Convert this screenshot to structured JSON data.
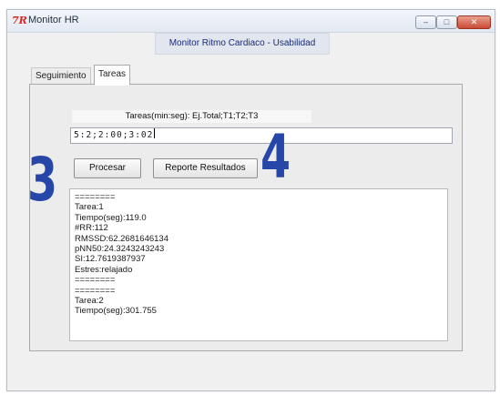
{
  "window": {
    "title": "Monitor HR",
    "icon_glyph": "7R",
    "controls": {
      "minimize_glyph": "–",
      "maximize_glyph": "□",
      "close_glyph": "✕"
    }
  },
  "header": {
    "title": "Monitor Ritmo Cardiaco - Usabilidad"
  },
  "tabs": [
    {
      "label": "Seguimiento",
      "active": false
    },
    {
      "label": "Tareas",
      "active": true
    }
  ],
  "tareas": {
    "format_label": "Tareas(min:seg): Ej.Total;T1;T2;T3",
    "input_value": "5:2;2:00;3:02",
    "buttons": {
      "procesar": "Procesar",
      "reporte": "Reporte Resultados"
    },
    "results_lines": [
      "========",
      "Tarea:1",
      "Tiempo(seg):119.0",
      "#RR:112",
      "RMSSD:62.2681646134",
      "pNN50:24.3243243243",
      "SI:12.7619387937",
      "Estres:relajado",
      "========",
      "========",
      "Tarea:2",
      "Tiempo(seg):301.755"
    ]
  },
  "annotations": {
    "step_3": "3",
    "step_4": "4",
    "color": "#2747a8"
  }
}
